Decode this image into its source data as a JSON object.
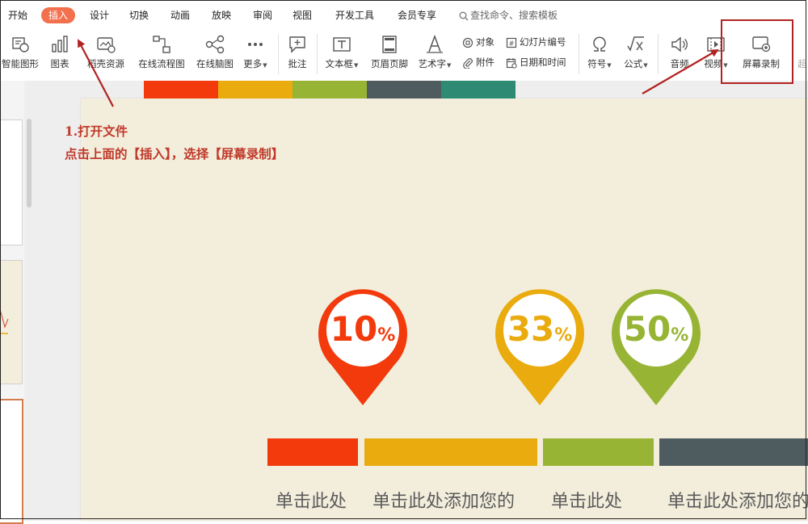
{
  "tabs": [
    {
      "label": "开始",
      "active": false
    },
    {
      "label": "插入",
      "active": true
    },
    {
      "label": "设计",
      "active": false
    },
    {
      "label": "切换",
      "active": false
    },
    {
      "label": "动画",
      "active": false
    },
    {
      "label": "放映",
      "active": false
    },
    {
      "label": "审阅",
      "active": false
    },
    {
      "label": "视图",
      "active": false
    },
    {
      "label": "开发工具",
      "active": false
    },
    {
      "label": "会员专享",
      "active": false
    }
  ],
  "search": {
    "placeholder": "查找命令、搜索模板"
  },
  "ribbon": {
    "smart_shape": "智能图形",
    "chart": "图表",
    "resources": "稻壳资源",
    "flowchart": "在线流程图",
    "mindmap": "在线脑图",
    "more": "更多",
    "comment": "批注",
    "textbox": "文本框",
    "header_footer": "页眉页脚",
    "wordart": "艺术字",
    "object": "对象",
    "slide_number": "幻灯片编号",
    "attachment": "附件",
    "date_time": "日期和时间",
    "symbol": "符号",
    "formula": "公式",
    "audio": "音频",
    "video": "视频",
    "screen_record": "屏幕录制",
    "truncated": "超"
  },
  "annotation": {
    "line1": "1.打开文件",
    "line2": "点击上面的【插入】，选择【屏幕录制】"
  },
  "slide": {
    "pins": [
      {
        "value": "10",
        "unit": "%",
        "color": "#f23a0c"
      },
      {
        "value": "33",
        "unit": "%",
        "color": "#e9ab0d"
      },
      {
        "value": "50",
        "unit": "%",
        "color": "#97b434"
      }
    ],
    "texts": [
      "单击此处",
      "单击此处添加您的",
      "单击此处",
      "单击此处添加您的"
    ],
    "colors": {
      "red": "#f23a0c",
      "orange": "#e9ab0d",
      "green": "#97b434",
      "slate": "#4f5c5f",
      "teal": "#2e8a72",
      "bg": "#f3eedc"
    }
  },
  "colors": {
    "tab_active": "#f2704e",
    "annotation": "#c0392b"
  }
}
